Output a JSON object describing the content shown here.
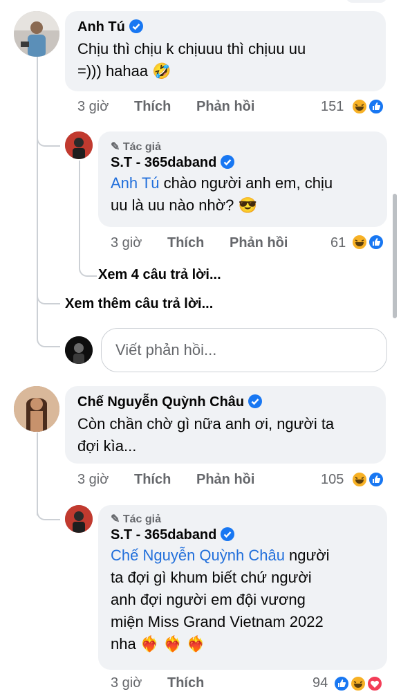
{
  "comments": [
    {
      "name": "Anh Tú",
      "text_line1": "Chịu thì chịu k chịuuu thì chịuu uu",
      "text_line2": "=))) hahaa 🤣",
      "time": "3 giờ",
      "like_label": "Thích",
      "reply_label": "Phản hồi",
      "reaction_count": "151",
      "reaction_icons": [
        "haha-icon",
        "like-icon"
      ]
    },
    {
      "author_tag": "✎ Tác giả",
      "name": "S.T - 365daband",
      "mention": "Anh Tú",
      "text_line1_rest": " chào người anh em, chịu",
      "text_line2": "uu là uu nào nhờ? 😎",
      "time": "3 giờ",
      "like_label": "Thích",
      "reply_label": "Phản hồi",
      "reaction_count": "61",
      "reaction_icons": [
        "haha-icon",
        "like-icon"
      ]
    },
    {
      "name": "Chế Nguyễn Quỳnh Châu",
      "text_line1": "Còn chần chờ gì nữa anh ơi, người ta",
      "text_line2": "đợi kìa...",
      "time": "3 giờ",
      "like_label": "Thích",
      "reply_label": "Phản hồi",
      "reaction_count": "105",
      "reaction_icons": [
        "haha-icon",
        "like-icon"
      ]
    },
    {
      "author_tag": "✎ Tác giả",
      "name": "S.T - 365daband",
      "mention": "Chế Nguyễn Quỳnh Châu",
      "text_line1_rest": " người",
      "text_line2": "ta đợi gì khum biết chứ người",
      "text_line3": "anh đợi người em đội vương",
      "text_line4": "miện Miss Grand Vietnam 2022",
      "text_line5": "nha ❤️‍🔥 ❤️‍🔥 ❤️‍🔥",
      "time": "3 giờ",
      "like_label": "Thích",
      "reaction_count": "94",
      "reaction_icons": [
        "like-icon",
        "haha-icon",
        "love-icon"
      ]
    }
  ],
  "links": {
    "view_replies": "Xem 4 câu trả lời...",
    "view_more": "Xem thêm câu trả lời..."
  },
  "reply_input": {
    "placeholder": "Viết phản hồi..."
  },
  "colors": {
    "accent": "#1877f2",
    "bubble": "#f0f2f5",
    "secondary_text": "#65676b",
    "haha": "#f7b125",
    "love": "#f33e58"
  }
}
